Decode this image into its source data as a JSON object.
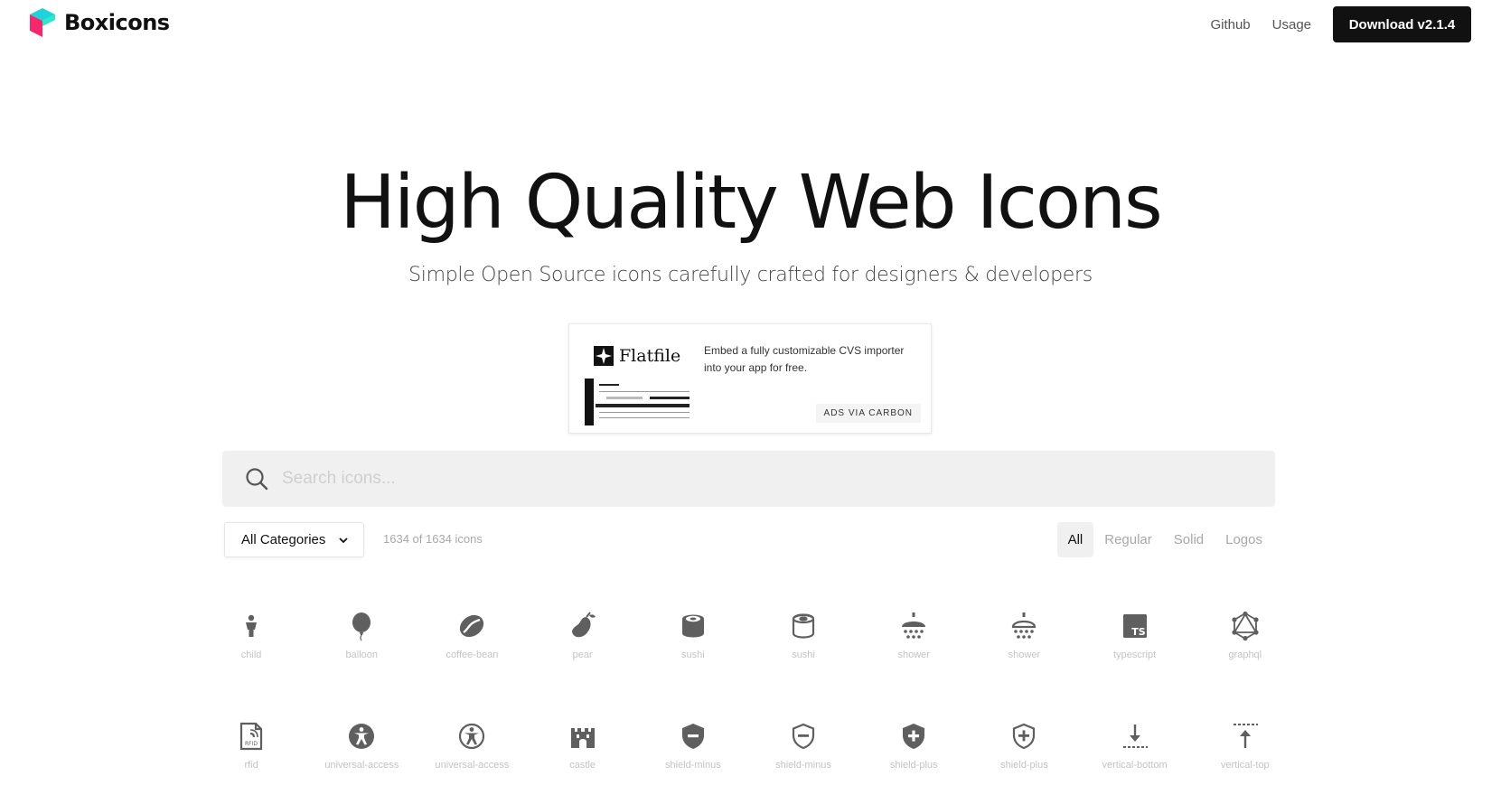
{
  "brand": {
    "name": "Boxicons"
  },
  "nav": {
    "github": "Github",
    "usage": "Usage",
    "download": "Download v2.1.4"
  },
  "hero": {
    "title": "High Quality Web Icons",
    "subtitle": "Simple Open Source icons carefully crafted for designers & developers"
  },
  "ad": {
    "brand": "Flatfile",
    "text": "Embed a fully customizable CVS importer into your app for free.",
    "via": "ADS VIA CARBON"
  },
  "search": {
    "placeholder": "Search icons..."
  },
  "filters": {
    "category": "All Categories",
    "count": "1634 of 1634 icons",
    "tabs": [
      "All",
      "Regular",
      "Solid",
      "Logos"
    ],
    "active_tab": "All"
  },
  "colors": {
    "accent_pink": "#f4296d",
    "accent_cyan": "#1ed4d8",
    "icon": "#5f5f5f",
    "button": "#111111"
  },
  "icons": [
    [
      {
        "label": "child",
        "icon": "child-icon"
      },
      {
        "label": "balloon",
        "icon": "balloon-icon"
      },
      {
        "label": "coffee-bean",
        "icon": "coffee-bean-icon"
      },
      {
        "label": "pear",
        "icon": "pear-icon"
      },
      {
        "label": "sushi",
        "icon": "sushi-icon"
      },
      {
        "label": "sushi",
        "icon": "sushi-outline-icon"
      },
      {
        "label": "shower",
        "icon": "shower-icon"
      },
      {
        "label": "shower",
        "icon": "shower-outline-icon"
      },
      {
        "label": "typescript",
        "icon": "typescript-icon"
      },
      {
        "label": "graphql",
        "icon": "graphql-icon"
      }
    ],
    [
      {
        "label": "rfid",
        "icon": "rfid-icon"
      },
      {
        "label": "universal-access",
        "icon": "universal-access-icon"
      },
      {
        "label": "universal-access",
        "icon": "universal-access-outline-icon"
      },
      {
        "label": "castle",
        "icon": "castle-icon"
      },
      {
        "label": "shield-minus",
        "icon": "shield-minus-icon"
      },
      {
        "label": "shield-minus",
        "icon": "shield-minus-outline-icon"
      },
      {
        "label": "shield-plus",
        "icon": "shield-plus-icon"
      },
      {
        "label": "shield-plus",
        "icon": "shield-plus-outline-icon"
      },
      {
        "label": "vertical-bottom",
        "icon": "vertical-bottom-icon"
      },
      {
        "label": "vertical-top",
        "icon": "vertical-top-icon"
      }
    ]
  ]
}
